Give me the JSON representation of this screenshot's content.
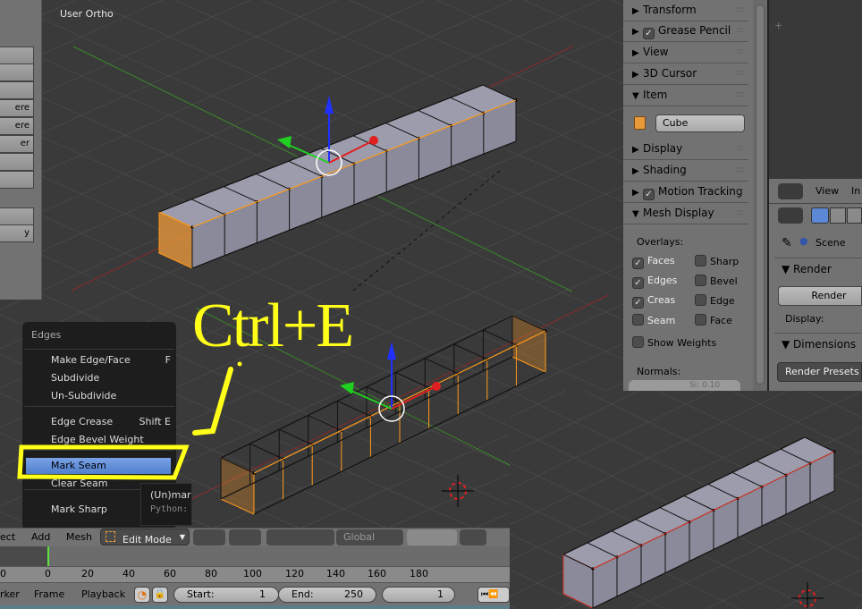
{
  "viewport_top": {
    "label": "User Ortho"
  },
  "tool_shelf": {
    "buttons": [
      "",
      "",
      "",
      "ere",
      "ere",
      "er",
      "",
      "",
      "",
      "y"
    ]
  },
  "n_panel": {
    "panels": [
      {
        "label": "Transform",
        "expanded": false,
        "checkbox": false
      },
      {
        "label": "Grease Pencil",
        "expanded": false,
        "checkbox": true
      },
      {
        "label": "View",
        "expanded": false,
        "checkbox": false
      },
      {
        "label": "3D Cursor",
        "expanded": false,
        "checkbox": false
      },
      {
        "label": "Item",
        "expanded": true,
        "checkbox": false
      },
      {
        "label": "Display",
        "expanded": false,
        "checkbox": false
      },
      {
        "label": "Shading",
        "expanded": false,
        "checkbox": false
      },
      {
        "label": "Motion Tracking",
        "expanded": false,
        "checkbox": true
      },
      {
        "label": "Mesh Display",
        "expanded": true,
        "checkbox": false
      }
    ],
    "item_name": "Cube",
    "overlays_label": "Overlays:",
    "overlays": [
      {
        "label": "Faces",
        "checked": true
      },
      {
        "label": "Sharp",
        "checked": false
      },
      {
        "label": "Edges",
        "checked": true
      },
      {
        "label": "Bevel",
        "checked": false
      },
      {
        "label": "Creas",
        "checked": true
      },
      {
        "label": "Edge",
        "checked": false
      },
      {
        "label": "Seam",
        "checked": false
      },
      {
        "label": "Face",
        "checked": false
      }
    ],
    "show_weights": {
      "label": "Show Weights",
      "checked": false
    },
    "normals_label": "Normals:",
    "normals_size": "Si: 0.10"
  },
  "properties": {
    "header_items": [
      "View",
      "In"
    ],
    "scene": "Scene",
    "render_section": "Render",
    "render_button": "Render",
    "display_label": "Display:",
    "dimensions_section": "Dimensions",
    "render_presets": "Render Presets"
  },
  "edges_menu": {
    "title": "Edges",
    "items": [
      {
        "label": "Make Edge/Face",
        "shortcut": "F"
      },
      {
        "label": "Subdivide",
        "shortcut": ""
      },
      {
        "label": "Un-Subdivide",
        "shortcut": ""
      },
      {
        "label": "Edge Crease",
        "shortcut": "Shift E"
      },
      {
        "label": "Edge Bevel Weight",
        "shortcut": ""
      },
      {
        "label": "Mark Seam",
        "shortcut": "",
        "highlighted": true
      },
      {
        "label": "Clear Seam",
        "shortcut": ""
      },
      {
        "label": "Mark Sharp",
        "shortcut": ""
      }
    ],
    "tooltip": {
      "text": "(Un)mark",
      "python": "Python:"
    }
  },
  "annotation": {
    "text": "Ctrl+E",
    "color": "#ffff19"
  },
  "header": {
    "menus": [
      "ect",
      "Add",
      "Mesh"
    ],
    "mode": "Edit Mode",
    "orientation": "Global"
  },
  "timeline": {
    "ticks": [
      "0",
      "0",
      "20",
      "40",
      "60",
      "80",
      "100",
      "120",
      "140",
      "160",
      "180"
    ],
    "current_frame_marker": 1
  },
  "bottom_bar": {
    "menus": [
      "rker",
      "Frame",
      "Playback"
    ],
    "start_label": "Start:",
    "start": "1",
    "end_label": "End:",
    "end": "250",
    "current": "1"
  },
  "colors": {
    "selection": "#ff9a1a",
    "seam": "#e03020",
    "highlight": "#5c89d6"
  }
}
